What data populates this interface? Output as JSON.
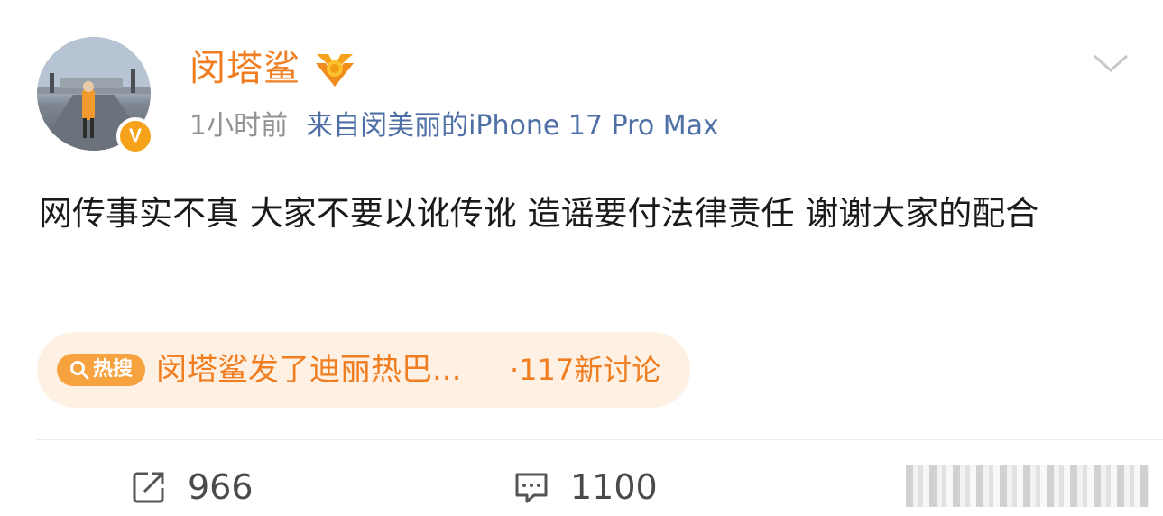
{
  "author": {
    "name": "闵塔鲨",
    "verified_badge": "V",
    "avatar_icon": "avatar-photo",
    "medal_icon": "gold-medal-icon"
  },
  "meta": {
    "time": "1小时前",
    "source": "来自闵美丽的iPhone 17 Pro Max"
  },
  "post": {
    "text": "网传事实不真 大家不要以讹传讹 造谣要付法律责任 谢谢大家的配合"
  },
  "hot_search": {
    "tag": "热搜",
    "title": "闵塔鲨发了迪丽热巴...",
    "count": "·117新讨论"
  },
  "actions": {
    "repost_count": "966",
    "comment_count": "1100"
  },
  "colors": {
    "accent": "#f07d1f",
    "link": "#4f6fa7",
    "hot_bg": "#fef1e4",
    "badge": "#f7a21b"
  }
}
